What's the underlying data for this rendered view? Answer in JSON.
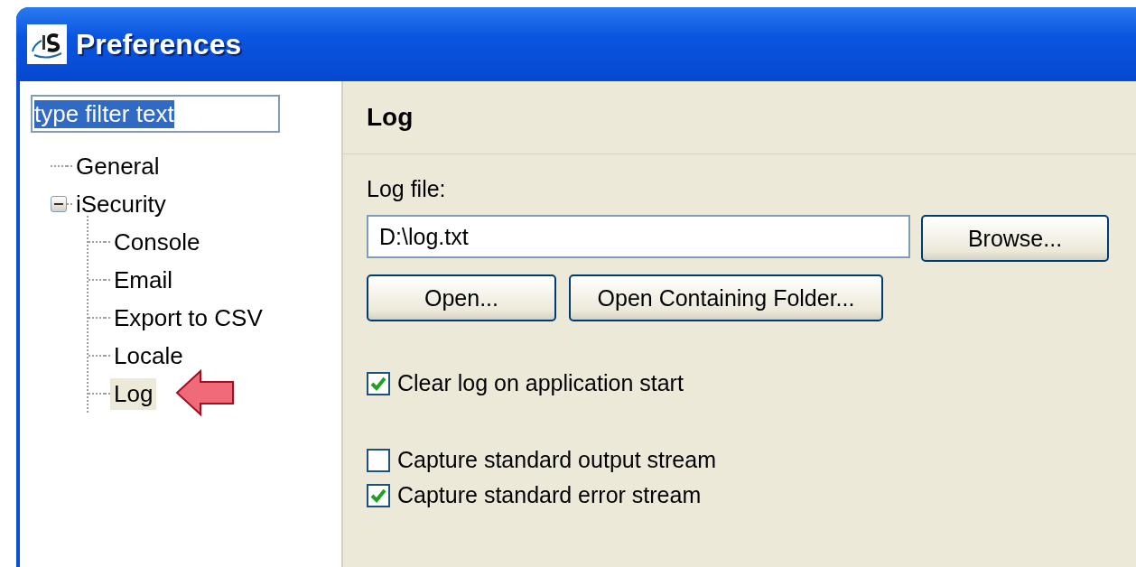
{
  "window": {
    "title": "Preferences"
  },
  "filter": {
    "value": "type filter text",
    "text_selected": true
  },
  "tree": [
    {
      "label": "General",
      "selected": false
    },
    {
      "label": "iSecurity",
      "selected": false,
      "expanded": true,
      "children": [
        {
          "label": "Console",
          "selected": false
        },
        {
          "label": "Email",
          "selected": false
        },
        {
          "label": "Export to CSV",
          "selected": false
        },
        {
          "label": "Locale",
          "selected": false
        },
        {
          "label": "Log",
          "selected": true
        }
      ]
    }
  ],
  "page": {
    "title": "Log",
    "log_file_label": "Log file:",
    "log_file_value": "D:\\log.txt",
    "browse_button": "Browse...",
    "buttons": [
      "Open...",
      "Open Containing Folder..."
    ],
    "checkboxes": [
      {
        "label": "Clear log on application start",
        "checked": true
      },
      {
        "label": "Capture standard output stream",
        "checked": false
      },
      {
        "label": "Capture standard error stream",
        "checked": true
      }
    ]
  }
}
